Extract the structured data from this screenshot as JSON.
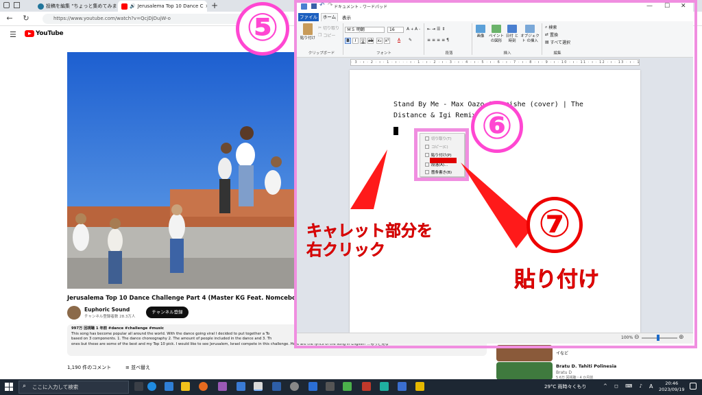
{
  "browser": {
    "tabs": [
      {
        "title": "投稿を編集 \"ちょっと集めてみます"
      },
      {
        "title": "Jerusalema Top 10 Dance C"
      }
    ],
    "url": "https://www.youtube.com/watch?v=QcjDjDujW-o"
  },
  "youtube": {
    "logo": "YouTube",
    "video_title": "Jerusalema Top 10 Dance Challenge Part 4 (Master KG Feat. Nomcebo Remix)",
    "channel_name": "Euphoric Sound",
    "channel_subs": "チャンネル登録者数 28.3万人",
    "subscribe_label": "チャンネル登録",
    "desc_meta": "997万 回視聴 1 年前 #dance #challenge #music",
    "desc_line1": "This song has become popular all around the world. With the dance going viral I decided to put together a To",
    "desc_line2": "based on 3 components. 1. The dance choreography 2. The amount of people included in the dance and 3. Th",
    "desc_line3": "ones but these are some of the best and my Top 10 pick. I would like to see Jerusalem, Israel compete in this challenge. Here are the lyrics of the song in English! ...もっと見る",
    "comments_count": "1,190 件のコメント",
    "sort_label": "並べ替え",
    "side_videos": [
      {
        "text": "イなど"
      },
      {
        "title": "Bratu D. Tahiti Polinesia",
        "channel": "Bratu D",
        "meta": "5.6万 回視聴・4 か月前"
      }
    ]
  },
  "wordpad": {
    "title": "ドキュメント - ワードパッド",
    "tabs": {
      "file": "ファイル",
      "home": "ホーム",
      "view": "表示"
    },
    "clipboard": {
      "paste": "貼り付け",
      "cut": "切り取り",
      "copy": "コピー",
      "group": "クリップボード"
    },
    "font": {
      "name": "ＭＳ 明朝",
      "size": "16",
      "group": "フォント"
    },
    "paragraph_group": "段落",
    "insert": {
      "picture": "画像",
      "paint": "ペイント の図形",
      "datetime": "日付 と時刻",
      "object": "オブジェクト の挿入",
      "group": "挿入"
    },
    "editing": {
      "find": "検索",
      "replace": "置換",
      "select_all": "すべて選択",
      "group": "編集"
    },
    "ruler_text": "· 3 · ı · 2 · ı · 1 · ı · · · ı · 1 · ı · 2 · ı · 3 · ı · 4 · ı · 5 · ı · 6 · ı · 7 · ı · 8 · ı · 9 · ı · 10 · ı · 11 · ı · 12 · ı · 13 · ı · 14 · ı · 15 · ı · 16 · ı · 17 ·",
    "document_line1": "Stand By Me - Max Oazo & Camishe (cover) | The",
    "document_line2": "Distance & Igi Remix",
    "zoom": "100%",
    "context_menu": [
      "切り取り(T)",
      "コピー(C)",
      "貼り付け(P)",
      "段落(A)...",
      "箇条書き(B)"
    ]
  },
  "annotations": {
    "step5": "⑤",
    "step6": "⑥",
    "step7": "⑦",
    "caret_note_line1": "キャレット部分を",
    "caret_note_line2": "右クリック",
    "paste_note": "貼り付け"
  },
  "taskbar": {
    "search_placeholder": "ここに入力して検索",
    "weather": "29°C 雨時々くもり",
    "ime": "A",
    "time": "20:46",
    "date": "2023/09/19"
  },
  "colors": {
    "annotation_pink": "#ff47d2",
    "annotation_red": "#ee0000",
    "wordpad_file_tab": "#1c5fbf",
    "youtube_red": "#ff0000"
  }
}
